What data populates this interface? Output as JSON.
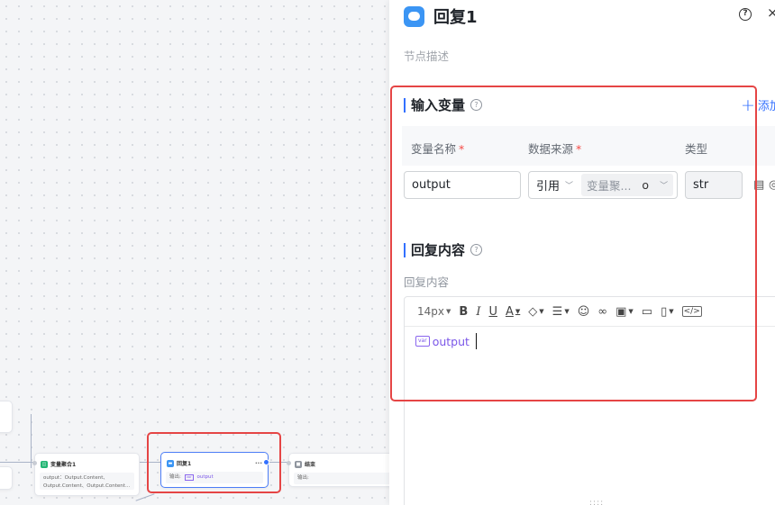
{
  "canvas": {
    "nodes": {
      "aggregate": {
        "title": "变量聚合1",
        "body": "output：Output.Content、Output.Content、Output.Content..."
      },
      "reply": {
        "title": "回复1",
        "more": "···",
        "output_label": "输出:",
        "var_tag": "var",
        "var_name": "output"
      },
      "end": {
        "title": "结束",
        "output_label": "输出:"
      }
    }
  },
  "panel": {
    "title": "回复1",
    "help": "?",
    "close": "×",
    "description_placeholder": "节点描述",
    "inputs": {
      "title": "输入变量",
      "help": "?",
      "add_label": "添加",
      "columns": {
        "name": "变量名称",
        "source": "数据来源",
        "type": "类型"
      },
      "required_mark": "*",
      "row": {
        "name": "output",
        "source_mode": "引用",
        "source_value": "变量聚...",
        "source_suffix": "o",
        "type": "str"
      }
    },
    "reply": {
      "title": "回复内容",
      "help": "?",
      "label": "回复内容",
      "toolbar": {
        "font_size": "14px"
      },
      "content_var_tag": "var",
      "content_var": "output"
    },
    "drag_handle": "::::"
  },
  "colors": {
    "accent": "#3370ff",
    "highlight": "#e54545",
    "variable": "#7a56e8"
  }
}
